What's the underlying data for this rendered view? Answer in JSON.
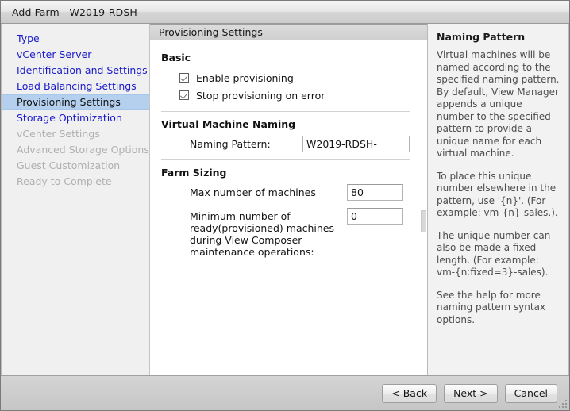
{
  "window": {
    "title": "Add Farm - W2019-RDSH"
  },
  "sidebar": {
    "items": [
      {
        "label": "Type",
        "state": "done"
      },
      {
        "label": "vCenter Server",
        "state": "done"
      },
      {
        "label": "Identification and Settings",
        "state": "done"
      },
      {
        "label": "Load Balancing Settings",
        "state": "done"
      },
      {
        "label": "Provisioning Settings",
        "state": "selected"
      },
      {
        "label": "Storage Optimization",
        "state": "done"
      },
      {
        "label": "vCenter Settings",
        "state": "disabled"
      },
      {
        "label": "Advanced Storage Options",
        "state": "disabled"
      },
      {
        "label": "Guest Customization",
        "state": "disabled"
      },
      {
        "label": "Ready to Complete",
        "state": "disabled"
      }
    ]
  },
  "content": {
    "header": "Provisioning Settings",
    "basic": {
      "title": "Basic",
      "checkboxes": [
        {
          "label": "Enable provisioning",
          "checked": true
        },
        {
          "label": "Stop provisioning on error",
          "checked": true
        }
      ]
    },
    "vm_naming": {
      "title": "Virtual Machine Naming",
      "naming_pattern_label": "Naming Pattern:",
      "naming_pattern_value": "W2019-RDSH-"
    },
    "farm_sizing": {
      "title": "Farm Sizing",
      "max_machines_label": "Max number of machines",
      "max_machines_value": "80",
      "min_ready_label": "Minimum number of ready(provisioned) machines during View Composer maintenance operations:",
      "min_ready_value": "0"
    }
  },
  "help": {
    "title": "Naming Pattern",
    "paragraphs": [
      "Virtual machines will be named according to the specified naming pattern. By default, View Manager appends a unique number to the specified pattern to provide a unique name for each virtual machine.",
      "To place this unique number elsewhere in the pattern, use '{n}'. (For example: vm-{n}-sales.).",
      "The unique number can also be made a fixed length. (For example: vm-{n:fixed=3}-sales).",
      "See the help for more naming pattern syntax options."
    ]
  },
  "footer": {
    "back_label": "< Back",
    "next_label": "Next >",
    "cancel_label": "Cancel"
  },
  "colors": {
    "link": "#1a1aca",
    "selected_bg": "#b5d0ef",
    "disabled_text": "#b0b0b0"
  }
}
